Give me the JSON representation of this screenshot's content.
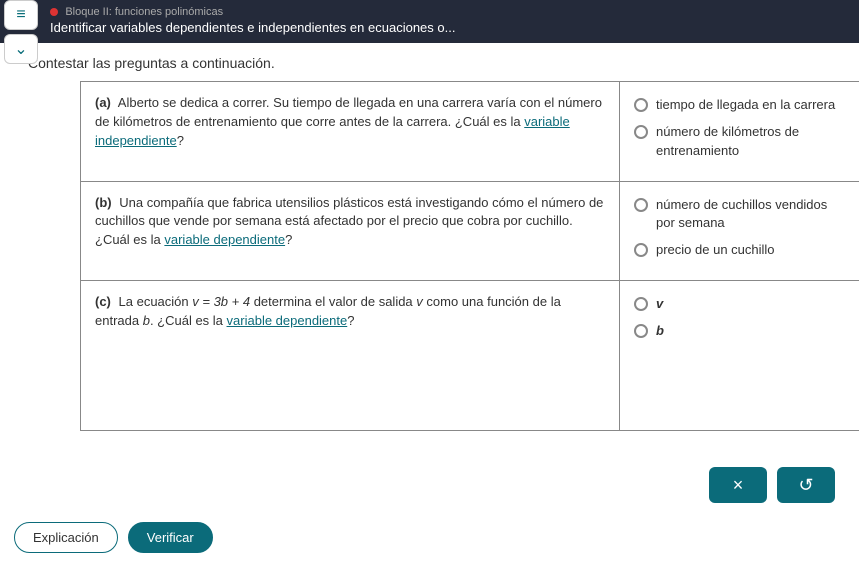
{
  "header": {
    "block": "Bloque II: funciones polinómicas",
    "topic": "Identificar variables dependientes e independientes en ecuaciones o..."
  },
  "instruction": "Contestar las preguntas a continuación.",
  "questions": [
    {
      "label": "(a)",
      "text_pre": "Alberto se dedica a correr. Su tiempo de llegada en una carrera varía con el número de kilómetros de entrenamiento que corre antes de la carrera. ¿Cuál es la ",
      "link": "variable independiente",
      "text_post": "?",
      "options": [
        "tiempo de llegada en la carrera",
        "número de kilómetros de entrenamiento"
      ]
    },
    {
      "label": "(b)",
      "text_pre": "Una compañía que fabrica utensilios plásticos está investigando cómo el número de cuchillos que vende por semana está afectado por el precio que cobra por cuchillo. ¿Cuál es la ",
      "link": "variable dependiente",
      "text_post": "?",
      "options": [
        "número de cuchillos vendidos por semana",
        "precio de un cuchillo"
      ]
    },
    {
      "label": "(c)",
      "eq_pre": "La ecuación ",
      "eq": "v = 3b + 4",
      "eq_mid": " determina el valor de salida ",
      "eq_v": "v",
      "eq_mid2": " como una función de la entrada ",
      "eq_b": "b",
      "eq_end": ". ¿Cuál es la ",
      "link": "variable dependiente",
      "text_post": "?",
      "options": [
        "v",
        "b"
      ]
    }
  ],
  "buttons": {
    "close": "×",
    "undo": "↺",
    "explain": "Explicación",
    "verify": "Verificar",
    "menu": "≡",
    "chevron": "⌄"
  }
}
